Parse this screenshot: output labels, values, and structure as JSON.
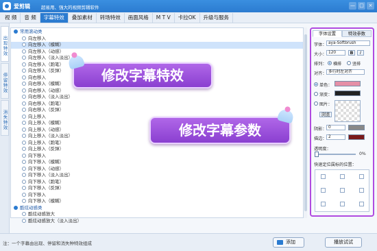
{
  "title": {
    "app_name": "爱剪辑",
    "tagline": "超易用、强大的视频剪辑软件",
    "window_buttons": [
      "—",
      "□",
      "×"
    ]
  },
  "menu": [
    "视 频",
    "音 频",
    "字幕特效",
    "叠加素材",
    "转场特效",
    "画面风格",
    "M T V",
    "卡拉OK",
    "升级与服务"
  ],
  "menu_active": 2,
  "side_tabs": [
    "出现特效",
    "停留特效",
    "消失特效"
  ],
  "list": [
    {
      "kind": "group",
      "label": "常用滚动类"
    },
    {
      "kind": "item",
      "label": "向左移入"
    },
    {
      "kind": "item",
      "label": "向左移入（模糊）",
      "selected": true
    },
    {
      "kind": "item",
      "label": "向左移入（动感）"
    },
    {
      "kind": "item",
      "label": "向左移入（淡入淡出）"
    },
    {
      "kind": "item",
      "label": "向左移入（跑笔）"
    },
    {
      "kind": "item",
      "label": "向左移入（反弹）"
    },
    {
      "kind": "item",
      "label": "向右移入"
    },
    {
      "kind": "item",
      "label": "向右移入（模糊）"
    },
    {
      "kind": "item",
      "label": "向右移入（动感）"
    },
    {
      "kind": "item",
      "label": "向右移入（淡入淡出）"
    },
    {
      "kind": "item",
      "label": "向右移入（跑笔）"
    },
    {
      "kind": "item",
      "label": "向右移入（反弹）"
    },
    {
      "kind": "item",
      "label": "向上移入"
    },
    {
      "kind": "item",
      "label": "向上移入（模糊）"
    },
    {
      "kind": "item",
      "label": "向上移入（动感）"
    },
    {
      "kind": "item",
      "label": "向上移入（淡入淡出）"
    },
    {
      "kind": "item",
      "label": "向上移入（跑笔）"
    },
    {
      "kind": "item",
      "label": "向上移入（反弹）"
    },
    {
      "kind": "item",
      "label": "向下移入"
    },
    {
      "kind": "item",
      "label": "向下移入（模糊）"
    },
    {
      "kind": "item",
      "label": "向下移入（动感）"
    },
    {
      "kind": "item",
      "label": "向下移入（淡入淡出）"
    },
    {
      "kind": "item",
      "label": "向下移入（跑笔）"
    },
    {
      "kind": "item",
      "label": "向下移入（反弹）"
    },
    {
      "kind": "item",
      "label": "向下移入"
    },
    {
      "kind": "item",
      "label": "向下移入（模糊）"
    },
    {
      "kind": "group",
      "label": "酷炫动感类"
    },
    {
      "kind": "item",
      "label": "酷炫动感放大"
    },
    {
      "kind": "item",
      "label": "酷炫动感放大（淡入淡出）"
    }
  ],
  "right_panel": {
    "tabs": [
      "字体设置",
      "特效参数"
    ],
    "font_label": "字体：",
    "font_value": "aya-Softbrush",
    "size_label": "大小：",
    "size_value": "120",
    "bold": "B",
    "italic": "I",
    "layout_label": "排列：",
    "horizontal": "横排",
    "vertical": "竖排",
    "align_label": "对齐：",
    "align_value": "多行时左对齐",
    "single_color": "单色：",
    "gradient": "渐变：",
    "image": "图片：",
    "browse": "浏览",
    "shadow_label": "阴影：",
    "shadow_value": "0",
    "stroke_label": "描边：",
    "stroke_value": "2",
    "opacity_label": "透明度：",
    "opacity_value": "0%",
    "position_label": "快速定位属标的位置："
  },
  "colors": {
    "single": "#e58fa6",
    "gradient": "#222222",
    "shadow": "#888888",
    "stroke": "#7a1a1a",
    "accent": "#2b7bd0",
    "banner": "#9b4fe0"
  },
  "bottom": {
    "hint": "注：一个字幕由出现、停留和消失种特效组成",
    "add_button": "添加",
    "play_button": "播放试试"
  },
  "banners": [
    {
      "text": "修改字幕特效"
    },
    {
      "text": "修改字幕参数"
    }
  ]
}
